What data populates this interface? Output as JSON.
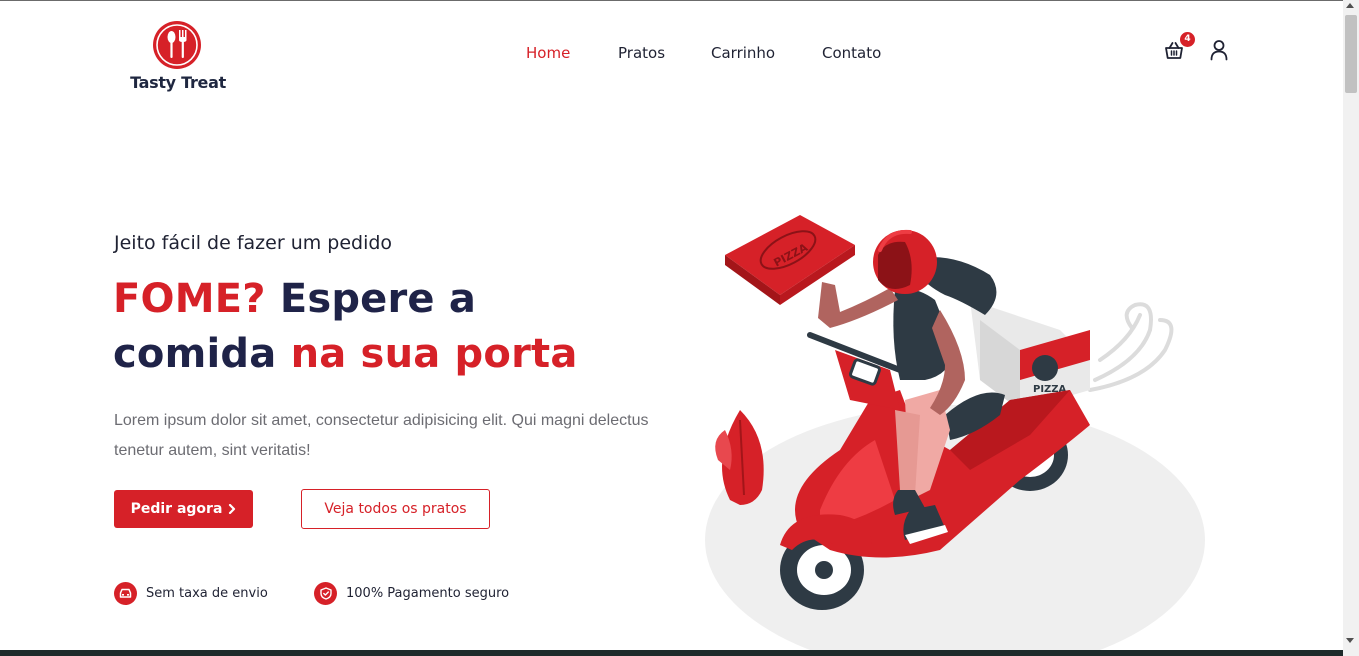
{
  "brand": {
    "name": "Tasty Treat",
    "accent_color": "#d62128",
    "logo_icon": "spoon-fork-icon"
  },
  "nav": {
    "items": [
      {
        "label": "Home",
        "active": true
      },
      {
        "label": "Pratos",
        "active": false
      },
      {
        "label": "Carrinho",
        "active": false
      },
      {
        "label": "Contato",
        "active": false
      }
    ]
  },
  "header_actions": {
    "cart_icon": "basket-icon",
    "cart_count": "4",
    "user_icon": "user-icon"
  },
  "hero": {
    "kicker": "Jeito fácil de fazer um pedido",
    "headline_red_1": "FOME?",
    "headline_dark_1": "Espere a",
    "headline_dark_2": "comida",
    "headline_red_2": "na sua porta",
    "description": "Lorem ipsum dolor sit amet, consectetur adipisicing elit. Qui magni delectus tenetur autem, sint veritatis!",
    "primary_button": "Pedir agora",
    "primary_button_icon": "chevron-right-icon",
    "secondary_button": "Veja todos os pratos"
  },
  "features": [
    {
      "icon": "car-icon",
      "label": "Sem taxa de envio"
    },
    {
      "icon": "shield-icon",
      "label": "100% Pagamento seguro"
    }
  ],
  "illustration": {
    "name": "pizza-delivery-scooter-illustration",
    "box_text": "PIZZA"
  }
}
